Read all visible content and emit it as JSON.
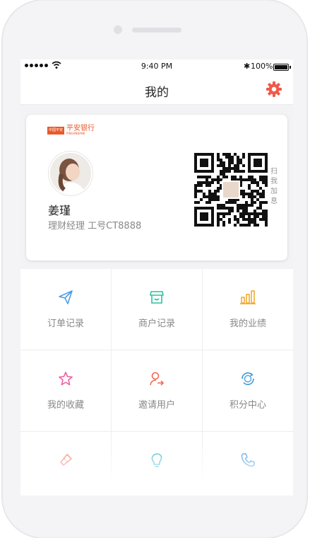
{
  "status_bar": {
    "time": "9:40 PM",
    "battery": "100%",
    "bluetooth": "✱"
  },
  "nav": {
    "title": "我的",
    "settings_icon": "gear-icon",
    "accent": "#f05a4a"
  },
  "profile": {
    "bank_name": "平安银行",
    "bank_name_en": "PINGANBANK",
    "logo_box_text": "中国平安",
    "name": "姜瑾",
    "role_line": "理财经理  工号CT8888",
    "scan_tip": "扫我加息"
  },
  "menu": [
    {
      "label": "订单记录",
      "icon": "paper-plane-icon",
      "color": "#4a9fe8"
    },
    {
      "label": "商户记录",
      "icon": "store-icon",
      "color": "#2fbfa0"
    },
    {
      "label": "我的业绩",
      "icon": "bar-chart-icon",
      "color": "#f0a623"
    },
    {
      "label": "我的收藏",
      "icon": "star-icon",
      "color": "#ef5fa0"
    },
    {
      "label": "邀请用户",
      "icon": "invite-user-icon",
      "color": "#f06a55"
    },
    {
      "label": "积分中心",
      "icon": "points-icon",
      "color": "#3c9ad8"
    },
    {
      "label": "",
      "icon": "ticket-icon",
      "color": "#f07a65"
    },
    {
      "label": "",
      "icon": "lightbulb-icon",
      "color": "#36b7c9"
    },
    {
      "label": "",
      "icon": "phone-icon",
      "color": "#3c93e0"
    }
  ]
}
